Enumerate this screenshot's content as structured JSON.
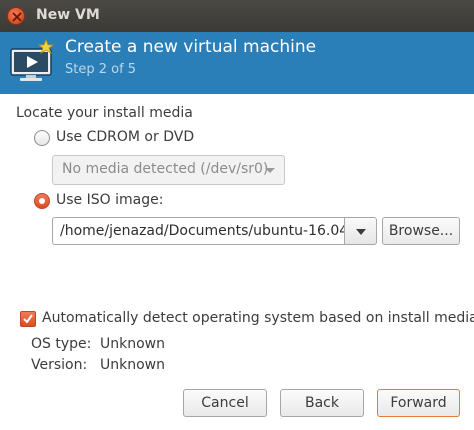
{
  "window": {
    "title": "New VM"
  },
  "header": {
    "title": "Create a new virtual machine",
    "step": "Step 2 of 5"
  },
  "media": {
    "section_label": "Locate your install media",
    "cdrom_label": "Use CDROM or DVD",
    "cdrom_value": "No media detected (/dev/sr0)",
    "iso_label": "Use ISO image:",
    "iso_path": "/home/jenazad/Documents/ubuntu-16.04",
    "browse_label": "Browse...",
    "selected": "iso"
  },
  "detect": {
    "label": "Automatically detect operating system based on install media",
    "checked": true
  },
  "os_info": {
    "type_key": "OS type:",
    "type_value": "Unknown",
    "version_key": "Version:",
    "version_value": "Unknown"
  },
  "buttons": {
    "cancel": "Cancel",
    "back": "Back",
    "forward": "Forward"
  },
  "colors": {
    "header_bg": "#2a7fb8",
    "accent_orange": "#dd4c22",
    "titlebar_bg": "#3b3a36"
  }
}
